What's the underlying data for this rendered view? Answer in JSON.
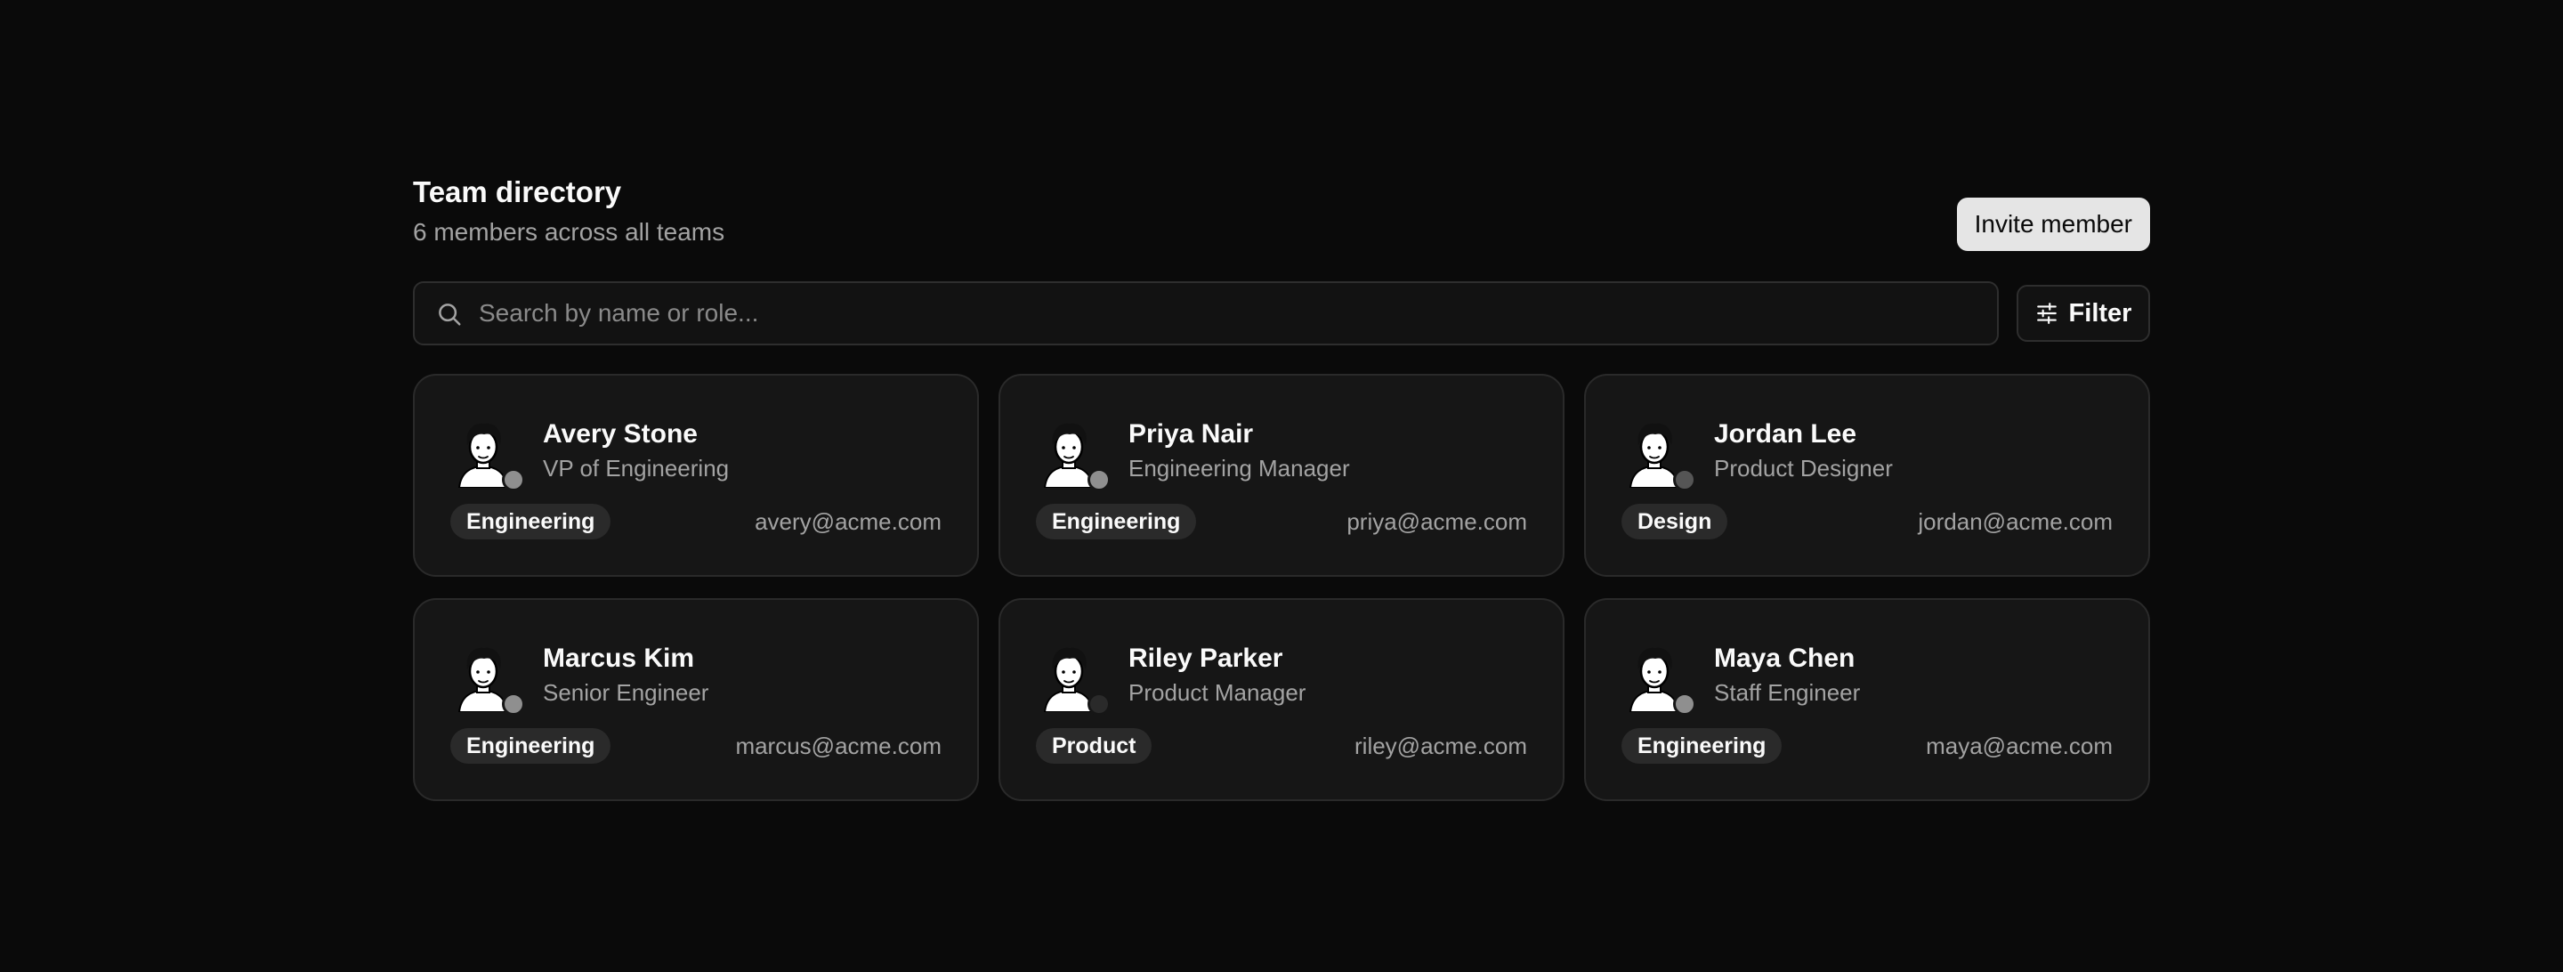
{
  "header": {
    "title": "Team directory",
    "subtitle": "6 members across all teams",
    "invite_label": "Invite member"
  },
  "search": {
    "placeholder": "Search by name or role...",
    "value": "",
    "icon": "search-icon"
  },
  "filter": {
    "label": "Filter",
    "icon": "sliders-icon"
  },
  "colors": {
    "background": "#0a0a0a",
    "card": "#161616",
    "accent_button": "#e5e5e5"
  },
  "members": [
    {
      "name": "Avery Stone",
      "role": "VP of Engineering",
      "team": "Engineering",
      "email": "avery@acme.com",
      "status_color": "#8f8f8f"
    },
    {
      "name": "Priya Nair",
      "role": "Engineering Manager",
      "team": "Engineering",
      "email": "priya@acme.com",
      "status_color": "#8f8f8f"
    },
    {
      "name": "Jordan Lee",
      "role": "Product Designer",
      "team": "Design",
      "email": "jordan@acme.com",
      "status_color": "#555555"
    },
    {
      "name": "Marcus Kim",
      "role": "Senior Engineer",
      "team": "Engineering",
      "email": "marcus@acme.com",
      "status_color": "#8f8f8f"
    },
    {
      "name": "Riley Parker",
      "role": "Product Manager",
      "team": "Product",
      "email": "riley@acme.com",
      "status_color": "#2a2a2a"
    },
    {
      "name": "Maya Chen",
      "role": "Staff Engineer",
      "team": "Engineering",
      "email": "maya@acme.com",
      "status_color": "#8f8f8f"
    }
  ]
}
